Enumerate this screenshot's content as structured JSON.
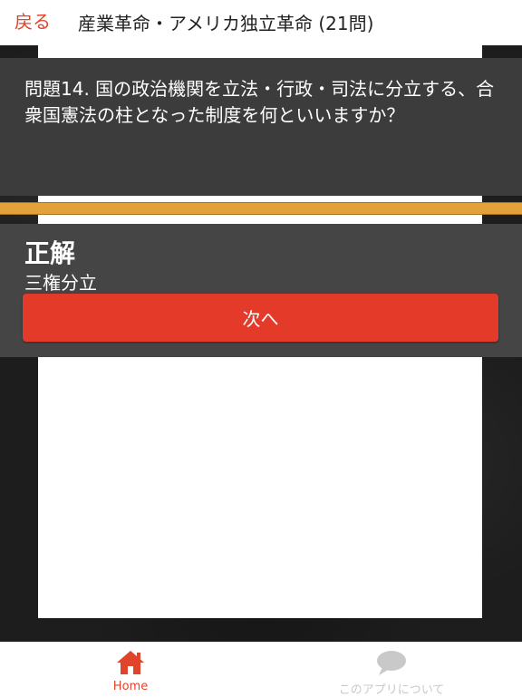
{
  "header": {
    "back_label": "戻る",
    "title": "産業革命・アメリカ独立革命 (21問)"
  },
  "question": {
    "text": "問題14. 国の政治機関を立法・行政・司法に分立する、合衆国憲法の柱となった制度を何といいますか？"
  },
  "result": {
    "verdict": "正解",
    "answer": "三権分立",
    "next_label": "次へ"
  },
  "bottom_nav": {
    "home_label": "Home",
    "about_label": "このアプリについて"
  },
  "colors": {
    "accent": "#e0452c",
    "next_button": "#e43a2a",
    "progress": "#e3a13a",
    "inactive": "#c9c9c9"
  },
  "icons": {
    "home": "home-icon",
    "about": "speech-bubble-icon"
  }
}
